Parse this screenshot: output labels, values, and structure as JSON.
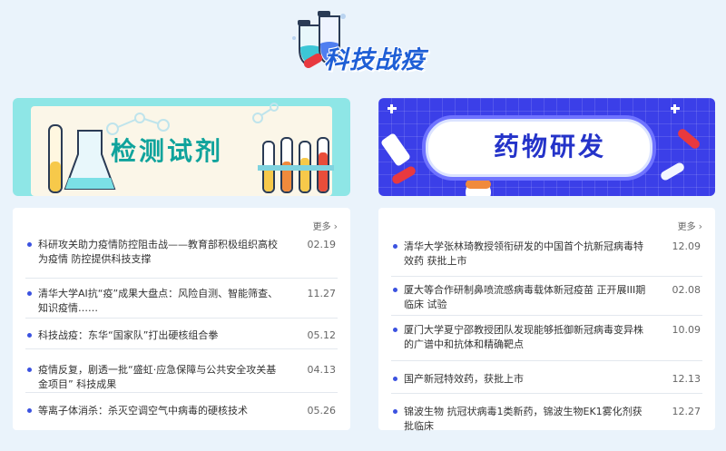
{
  "header": {
    "title": "科技战疫",
    "logo_icon": "flask-logo-icon"
  },
  "banners": {
    "left": {
      "title": "检测试剂"
    },
    "right": {
      "title": "药物研发"
    }
  },
  "colors": {
    "accent": "#1f5fd6",
    "teal": "#0fa39c",
    "indigo": "#3b3fe8",
    "dot": "#3b52e0"
  },
  "left_panel": {
    "more_label": "更多",
    "items": [
      {
        "title": "科研攻关助力疫情防控阻击战——教育部积极组织高校为疫情 防控提供科技支撑",
        "date": "02.19"
      },
      {
        "title": "清华大学AI抗“疫”成果大盘点：风险自测、智能筛查、知识疫情……",
        "date": "11.27"
      },
      {
        "title": "科技战疫：东华“国家队”打出硬核组合拳",
        "date": "05.12"
      },
      {
        "title": "疫情反复，剧透一批“盛虹·应急保障与公共安全攻关基金项目” 科技成果",
        "date": "04.13"
      },
      {
        "title": "等离子体消杀：杀灭空调空气中病毒的硬核技术",
        "date": "05.26"
      }
    ]
  },
  "right_panel": {
    "more_label": "更多",
    "items": [
      {
        "title": "清华大学张林琦教授领衔研发的中国首个抗新冠病毒特效药 获批上市",
        "date": "12.09"
      },
      {
        "title": "厦大等合作研制鼻喷流感病毒载体新冠疫苗 正开展III期临床 试验",
        "date": "02.08"
      },
      {
        "title": "厦门大学夏宁邵教授团队发现能够抵御新冠病毒变异株的广谱中和抗体和精确靶点",
        "date": "10.09"
      },
      {
        "title": "国产新冠特效药，获批上市",
        "date": "12.13"
      },
      {
        "title": "锦波生物 抗冠状病毒1类新药，锦波生物EK1雾化剂获批临床",
        "date": "12.27"
      }
    ]
  }
}
